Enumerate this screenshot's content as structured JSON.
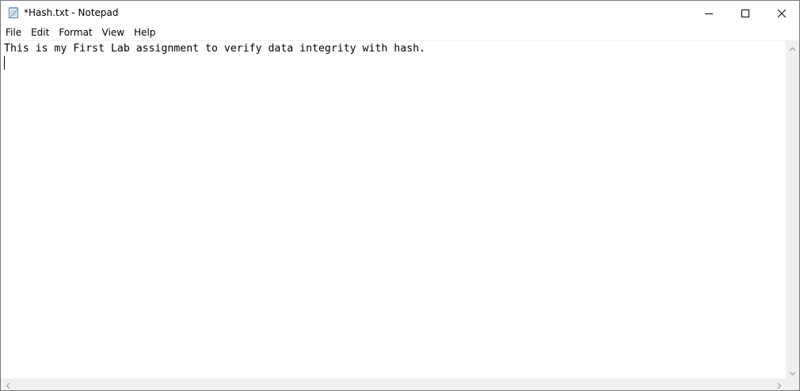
{
  "window": {
    "title": "*Hash.txt - Notepad",
    "app_icon": "notepad-icon"
  },
  "caption_buttons": {
    "minimize_icon": "minimize-icon",
    "maximize_icon": "maximize-icon",
    "close_icon": "close-icon"
  },
  "menu": {
    "items": [
      {
        "label": "File"
      },
      {
        "label": "Edit"
      },
      {
        "label": "Format"
      },
      {
        "label": "View"
      },
      {
        "label": "Help"
      }
    ]
  },
  "editor": {
    "lines": [
      "This is my First Lab assignment to verify data integrity with hash.",
      ""
    ]
  },
  "scrollbars": {
    "up_icon": "chevron-up-icon",
    "down_icon": "chevron-down-icon",
    "left_icon": "chevron-left-icon",
    "right_icon": "chevron-right-icon"
  },
  "colors": {
    "scrollbar_bg": "#f0f0f0",
    "text": "#000000",
    "window_bg": "#ffffff"
  }
}
